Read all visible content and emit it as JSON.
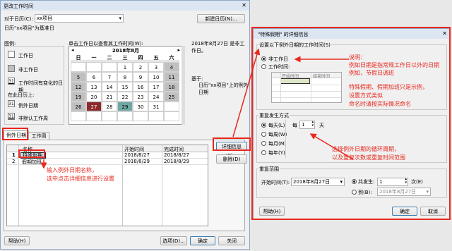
{
  "main_dialog": {
    "title": "更改工作时间",
    "close_glyph": "✕",
    "calendar_label": "对于日历(C):",
    "calendar_value": "xx项目",
    "new_calendar_button": "新建日历(N)...",
    "base_calendar_note": "日历\"xx项目\"为基准日",
    "legend_heading": "图例:",
    "legend_items": [
      "工作日",
      "非工作日",
      "工作时间有变化的日期"
    ],
    "legend_on_this_calendar": "在此日历上:",
    "legend_exception_day": "例外日期",
    "legend_nondefault_week": "非默认工作周",
    "legend_sample_num": "31",
    "calendar_instruction": "单击工作日以查看其工作时间(W):",
    "working_time_note": "2018年8月27日 是非工作日。",
    "based_on_label": "基于:",
    "based_on_value": "日历\"xx项目\"上的例外日期",
    "mini_calendar": {
      "month": "2018年8月",
      "weekdays": [
        "日",
        "一",
        "二",
        "三",
        "四",
        "五",
        "六"
      ],
      "rows": [
        [
          "",
          "",
          "",
          "1",
          "2",
          "3",
          "4"
        ],
        [
          "5",
          "6",
          "7",
          "8",
          "9",
          "10",
          "11"
        ],
        [
          "12",
          "13",
          "14",
          "15",
          "16",
          "17",
          "18"
        ],
        [
          "19",
          "20",
          "21",
          "22",
          "23",
          "24",
          "25"
        ],
        [
          "26",
          "27",
          "28",
          "29",
          "30",
          "31",
          ""
        ],
        [
          "",
          "",
          "",
          "",
          "",
          "",
          ""
        ]
      ],
      "highlight_exception": "27",
      "highlight_changed": "29"
    },
    "tabs": [
      "例外日期",
      "工作周"
    ],
    "table": {
      "headers": [
        "",
        "名称",
        "开始时间",
        "完成时间"
      ],
      "rows": [
        [
          "1",
          "特殊假期",
          "2018/8/27",
          "2018/8/27"
        ],
        [
          "2",
          "假期加班",
          "2018/8/29",
          "2018/8/29"
        ]
      ]
    },
    "details_button": "详细信息(E)...",
    "delete_button": "删除(D)",
    "help_button": "帮助(H)",
    "options_button": "选项(D)...",
    "ok_button": "确定",
    "cancel_button": "关闭"
  },
  "detail_dialog": {
    "title": "\"特殊假期\" 的详细信息",
    "close_glyph": "✕",
    "working_time_heading": "设置以下例外日期的工作时间(S)",
    "nonworking_radio": "非工作日",
    "working_time_radio": "工作时间:",
    "time_headers": [
      "",
      "开始时间",
      "结束时间"
    ],
    "recurrence_heading": "重复发生方式",
    "recurrence_options": [
      "每天(L)",
      "每周(W)",
      "每月(M)",
      "每年(Y)"
    ],
    "every_label": "每",
    "every_value": "1",
    "every_unit": "天",
    "range_heading": "重复范围",
    "start_label": "开始时间(T):",
    "start_value": "2018年8月27日",
    "total_label": "共发生:",
    "total_value": "1",
    "occurrences_unit": "次(E)",
    "end_label": "到(B):",
    "end_value": "2018年8月27日",
    "help_button": "帮助(H)",
    "ok_button": "确定",
    "cancel_button": "取消"
  },
  "annotations": {
    "note1": [
      "说明：",
      "例如日期是指常规工作日以外的日期",
      "例如，节假日调班"
    ],
    "note2": [
      "特殊假期、假期加班只是示例，",
      "设置方式类似",
      "命名时请按实际情况命名"
    ],
    "note3": [
      "选择例外日期的循环周期，",
      "以及重复次数或重复时间范围"
    ],
    "note4": [
      "输入例外日期名称，",
      "选中点击详细信息进行设置"
    ]
  },
  "colors": {
    "annotation_red": "#e8281e",
    "exception_day": "#8b2a2a",
    "changed_day": "#6fa7a3",
    "nonworking_gray": "#c0c0c0"
  }
}
